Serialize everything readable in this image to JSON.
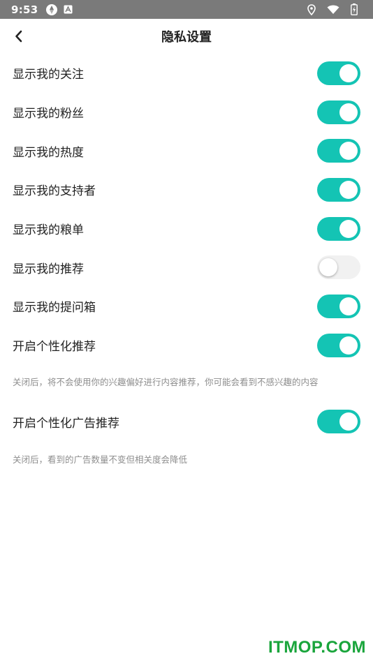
{
  "status_bar": {
    "time": "9:53"
  },
  "header": {
    "title": "隐私设置"
  },
  "settings": [
    {
      "label": "显示我的关注",
      "enabled": true
    },
    {
      "label": "显示我的粉丝",
      "enabled": true
    },
    {
      "label": "显示我的热度",
      "enabled": true
    },
    {
      "label": "显示我的支持者",
      "enabled": true
    },
    {
      "label": "显示我的粮单",
      "enabled": true
    },
    {
      "label": "显示我的推荐",
      "enabled": false
    },
    {
      "label": "显示我的提问箱",
      "enabled": true
    },
    {
      "label": "开启个性化推荐",
      "enabled": true
    },
    {
      "label": "开启个性化广告推荐",
      "enabled": true
    }
  ],
  "hints": {
    "personalized": "关闭后，将不会使用你的兴趣偏好进行内容推荐，你可能会看到不感兴趣的内容",
    "ads": "关闭后，看到的广告数量不变但相关度会降低"
  },
  "watermark": "ITMOP.COM",
  "colors": {
    "switch_on": "#14c4b4",
    "switch_off": "#f1f1f1",
    "status_bar": "#7a7a7a",
    "watermark": "#1aa53c"
  }
}
